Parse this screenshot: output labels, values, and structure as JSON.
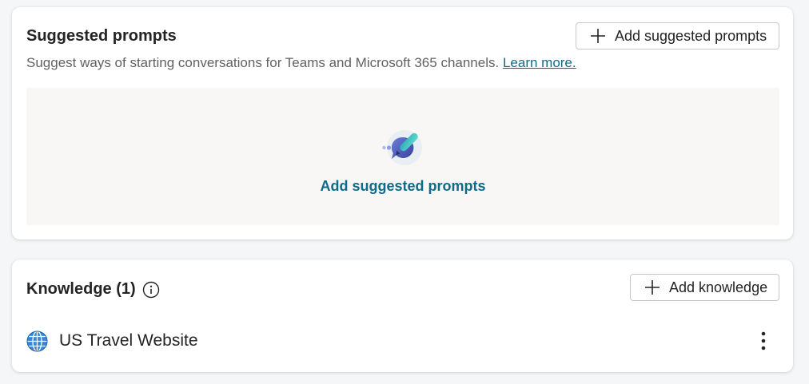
{
  "suggested_prompts": {
    "title": "Suggested prompts",
    "add_button_label": "Add suggested prompts",
    "description": "Suggest ways of starting conversations for Teams and Microsoft 365 channels.",
    "learn_more_label": "Learn more.",
    "empty_state_link_label": "Add suggested prompts",
    "icons": [
      "plus-icon",
      "prompt-illustration"
    ]
  },
  "knowledge": {
    "title": "Knowledge (1)",
    "add_button_label": "Add knowledge",
    "icons": [
      "info-icon",
      "plus-icon",
      "globe-icon",
      "more-vertical-icon"
    ],
    "items": [
      {
        "name": "US Travel Website",
        "icon": "globe-icon"
      }
    ]
  },
  "colors": {
    "background": "#f4f6f8",
    "card": "#ffffff",
    "link": "#0f6b8a",
    "empty_panel": "#f8f7f5",
    "muted_text": "#616161"
  }
}
